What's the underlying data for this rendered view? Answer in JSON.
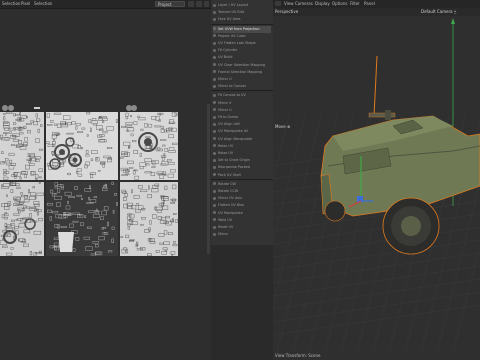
{
  "uv_editor": {
    "menu": [
      "Selection",
      "Pixel",
      "Selection"
    ],
    "projection_select": "Project"
  },
  "menu_panel": {
    "items": [
      "Layer / UV Layout",
      "Texture UV Edit",
      "Face UV Area",
      "Set UVW from Projection",
      "Project UV Cubic",
      "UV Flatten Last Shape",
      "Fit Cylinder",
      "UV Build",
      "UV Clear Selection Mapping",
      "Frontal Selection Mapping",
      "Mirror U",
      "Mirror to Canvas",
      "Fit Canvas to UV",
      "Mirror V",
      "Mirror U",
      "Fit to Gizmo",
      "UV Align Left",
      "UV Manipulate All",
      "UV Align Manipulate",
      "Relax UV",
      "Relax UV",
      "Set to Chart Origin",
      "Reorganise Packed",
      "Pack UV Shell",
      "Rotate CW",
      "Rotate CCW",
      "Mirror UV Axis",
      "Flatten UV Bias",
      "UV Manipulate",
      "Weld UV",
      "Reset UV",
      "Mirror"
    ],
    "highlighted": "Set UVW from Projection"
  },
  "viewport": {
    "menu": [
      "View",
      "Cameras",
      "Display",
      "Options",
      "Filter",
      "Panel"
    ],
    "mode_label": "Perspective",
    "camera_label": "Default Camera •̲",
    "move_label": "Move ⊕",
    "footer": "View Transform: Scene"
  },
  "colors": {
    "accent_green": "#3ea84a",
    "accent_blue": "#3a6fd8",
    "selection_orange": "#e07a1e",
    "vehicle_olive": "#6f7a55"
  }
}
